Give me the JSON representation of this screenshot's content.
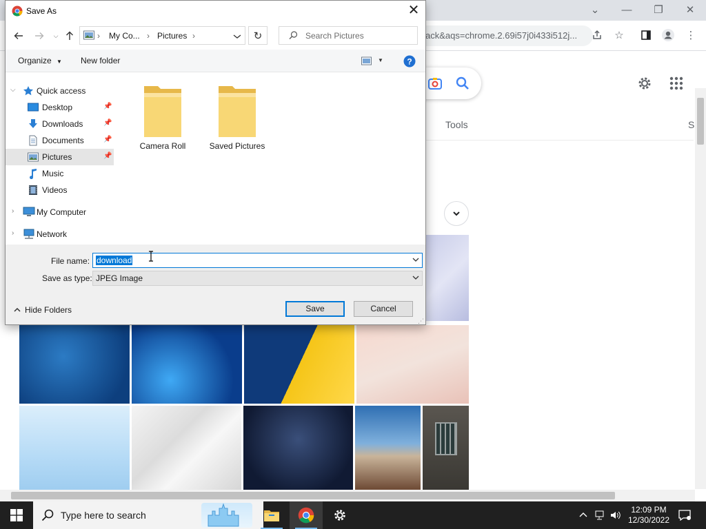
{
  "browser": {
    "omnibox_text": "ack&aqs=chrome.2.69i57j0i433i512j...",
    "tools_label": "Tools",
    "tab_partial_label": "S"
  },
  "dialog": {
    "title": "Save As",
    "address": {
      "segments": [
        "My Co...",
        "Pictures"
      ]
    },
    "search_placeholder": "Search Pictures",
    "toolbar": {
      "organize_label": "Organize",
      "new_folder_label": "New folder"
    },
    "nav_tree": [
      {
        "label": "Quick access"
      },
      {
        "label": "Desktop"
      },
      {
        "label": "Downloads"
      },
      {
        "label": "Documents"
      },
      {
        "label": "Pictures"
      },
      {
        "label": "Music"
      },
      {
        "label": "Videos"
      },
      {
        "label": "My Computer"
      },
      {
        "label": "Network"
      }
    ],
    "folders": [
      {
        "label": "Camera Roll"
      },
      {
        "label": "Saved Pictures"
      }
    ],
    "file_name_label": "File name:",
    "file_name_value": "download",
    "save_type_label": "Save as type:",
    "save_type_value": "JPEG Image",
    "hide_folders_label": "Hide Folders",
    "save_label": "Save",
    "cancel_label": "Cancel"
  },
  "taskbar": {
    "search_placeholder": "Type here to search",
    "time": "12:09 PM",
    "date": "12/30/2022"
  },
  "colors": {
    "accent": "#0078d7",
    "folder": "#f8d775",
    "taskbar": "#202020"
  }
}
